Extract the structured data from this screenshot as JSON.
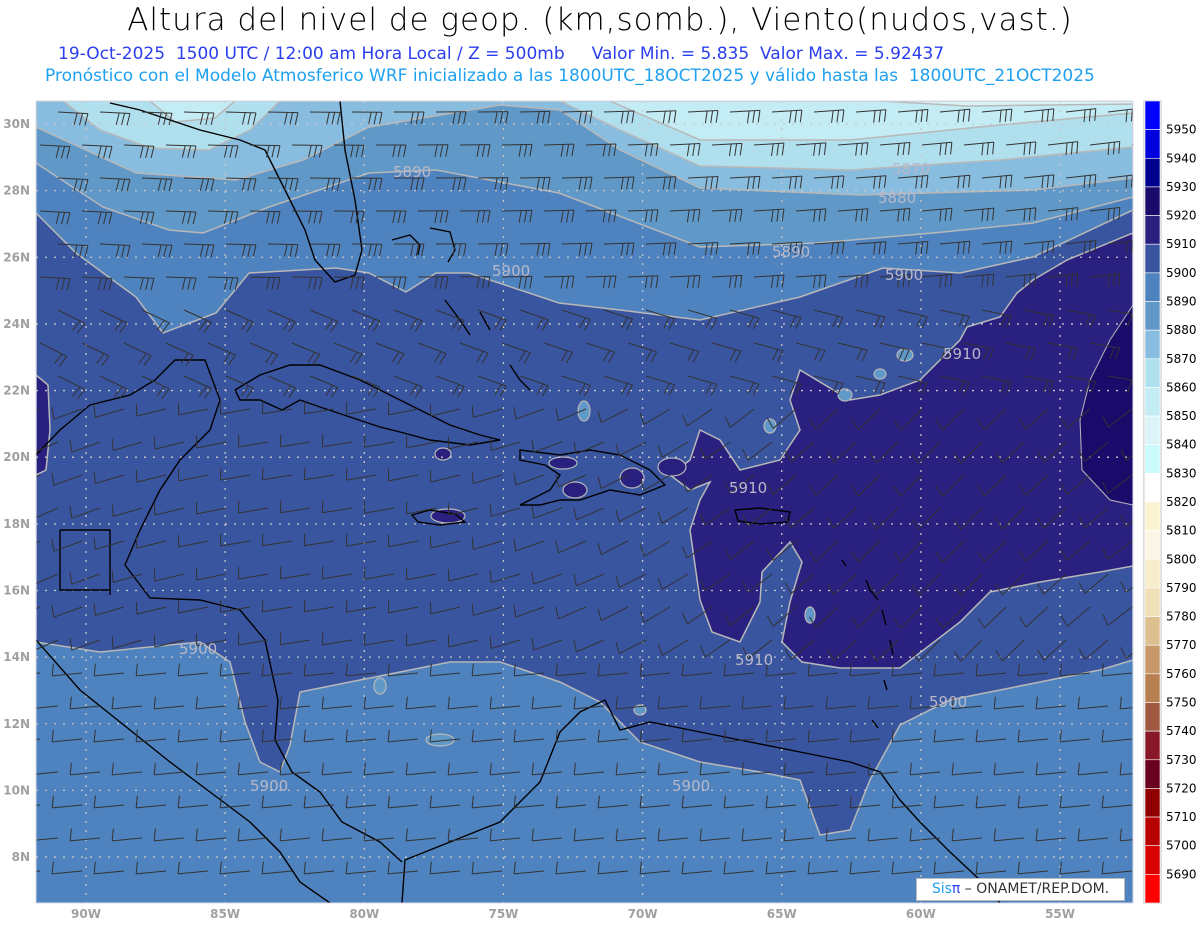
{
  "header": {
    "title": "Altura del nivel de geop. (km,somb.), Viento(nudos,vast.)",
    "subtitle_date": "19-Oct-2025  1500 UTC / 12:00 am Hora Local / Z = 500mb",
    "value_min": "Valor Min. = 5.835",
    "value_max": "Valor Max. = 5.92437",
    "model_info": "Pronóstico con el Modelo Atmosferico WRF inicializado a las 1800UTC_18OCT2025 y válido hasta las  1800UTC_21OCT2025"
  },
  "axes": {
    "longitude_labels": [
      "90W",
      "85W",
      "80W",
      "75W",
      "70W",
      "65W",
      "60W",
      "55W"
    ],
    "latitude_labels": [
      "8N",
      "10N",
      "12N",
      "14N",
      "16N",
      "18N",
      "20N",
      "22N",
      "24N",
      "26N",
      "28N",
      "30N"
    ]
  },
  "colorbar": {
    "labels": [
      "5950",
      "5940",
      "5930",
      "5920",
      "5910",
      "5900",
      "5890",
      "5880",
      "5870",
      "5860",
      "5850",
      "5840",
      "5830",
      "5820",
      "5810",
      "5800",
      "5790",
      "5780",
      "5770",
      "5760",
      "5750",
      "5740",
      "5730",
      "5720",
      "5710",
      "5700",
      "5690"
    ],
    "colors": [
      "#0000ff",
      "#0000dd",
      "#00008f",
      "#1a0a6a",
      "#2a2080",
      "#3a55a0",
      "#4f83bf",
      "#6098c8",
      "#88bde0",
      "#b0e0ee",
      "#c4ecf4",
      "#dcf4f8",
      "#cafafc",
      "#ffffff",
      "#faf3d0",
      "#fbf5e6",
      "#f7eccc",
      "#f0e0b8",
      "#dcc090",
      "#c8986a",
      "#b88050",
      "#a05840",
      "#881828",
      "#6a0020",
      "#900000",
      "#b80000",
      "#d80000",
      "#ff0000"
    ]
  },
  "contour_labels": [
    "5890",
    "5870",
    "5880",
    "5890",
    "5900",
    "5900",
    "5910",
    "5910",
    "5910",
    "5900",
    "5900",
    "5900",
    "5900",
    "5900"
  ],
  "credit": {
    "sis": "Sis",
    "pi": "π",
    "org": " – ONAMET/REP.DOM."
  }
}
